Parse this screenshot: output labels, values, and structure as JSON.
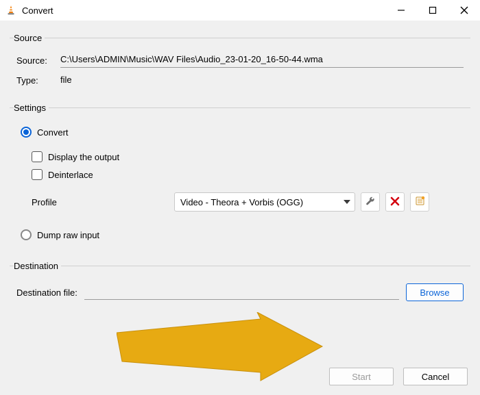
{
  "window": {
    "title": "Convert"
  },
  "source": {
    "legend": "Source",
    "source_label": "Source:",
    "source_value": "C:\\Users\\ADMIN\\Music\\WAV Files\\Audio_23-01-20_16-50-44.wma",
    "type_label": "Type:",
    "type_value": "file"
  },
  "settings": {
    "legend": "Settings",
    "convert_label": "Convert",
    "display_output_label": "Display the output",
    "deinterlace_label": "Deinterlace",
    "profile_label": "Profile",
    "profile_value": "Video - Theora + Vorbis (OGG)",
    "dump_raw_label": "Dump raw input"
  },
  "destination": {
    "legend": "Destination",
    "dest_file_label": "Destination file:",
    "dest_file_value": "",
    "browse_label": "Browse"
  },
  "footer": {
    "start_label": "Start",
    "cancel_label": "Cancel"
  },
  "icons": {
    "wrench": "wrench-icon",
    "delete": "delete-icon",
    "new_profile": "new-profile-icon"
  }
}
